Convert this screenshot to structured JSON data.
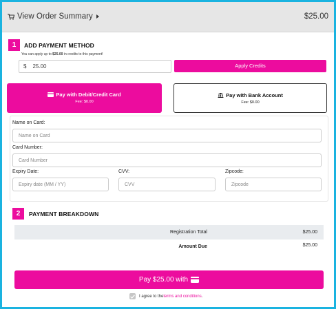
{
  "summary": {
    "label": "View Order Summary",
    "total": "$25.00"
  },
  "step1": {
    "number": "1",
    "title": "ADD PAYMENT METHOD",
    "credits_note_prefix": "You can apply up to ",
    "credits_note_amount": "$25.00",
    "credits_note_suffix": " in credits to this payment!",
    "currency_symbol": "$",
    "credit_value": "25.00",
    "apply_label": "Apply Credits"
  },
  "payment_tabs": [
    {
      "label": "Pay with Debit/Credit Card",
      "fee": "Fee: $0.00",
      "icon": "credit-card-icon",
      "active": true
    },
    {
      "label": "Pay with Bank Account",
      "fee": "Fee: $0.00",
      "icon": "bank-icon",
      "active": false
    }
  ],
  "card_form": {
    "name_label": "Name on Card:",
    "name_placeholder": "Name on Card",
    "number_label": "Card Number:",
    "number_placeholder": "Card Number",
    "expiry_label": "Expiry Date:",
    "expiry_placeholder": "Expiry date (MM / YY)",
    "cvv_label": "CVV:",
    "cvv_placeholder": "CVV",
    "zip_label": "Zipcode:",
    "zip_placeholder": "Zipcode"
  },
  "step2": {
    "number": "2",
    "title": "PAYMENT BREAKDOWN",
    "rows": [
      {
        "label": "Registration Total",
        "value": "$25.00"
      },
      {
        "label": "Amount Due",
        "value": "$25.00"
      }
    ]
  },
  "pay_button": {
    "label": "Pay $25.00 with",
    "icon": "credit-card-icon"
  },
  "terms": {
    "prefix": "I agree to the ",
    "link": "terms and conditions",
    "suffix": ".",
    "checked": true
  },
  "colors": {
    "accent": "#ec0c9e",
    "frame": "#1ab3e0",
    "summary_bg": "#e6e6e6"
  }
}
